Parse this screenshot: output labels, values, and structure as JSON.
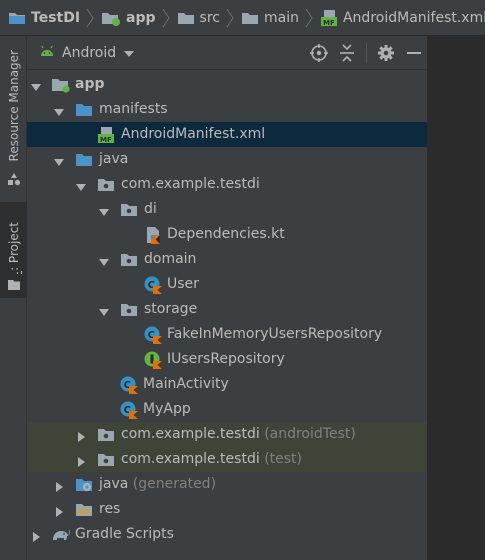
{
  "breadcrumb": {
    "items": [
      "TestDI",
      "app",
      "src",
      "main",
      "AndroidManifest.xml"
    ]
  },
  "toolstrip": {
    "resource_manager": "Resource Manager",
    "project_num": "1",
    "project_label": ": Project"
  },
  "panel": {
    "view": "Android"
  },
  "tree": {
    "app": "app",
    "manifests": "manifests",
    "android_manifest": "AndroidManifest.xml",
    "java": "java",
    "pkg_main": "com.example.testdi",
    "di": "di",
    "dependencies": "Dependencies.kt",
    "domain": "domain",
    "user": "User",
    "storage": "storage",
    "fake_repo": "FakeInMemoryUsersRepository",
    "iusers_repo": "IUsersRepository",
    "main_activity": "MainActivity",
    "my_app": "MyApp",
    "pkg_android_test": "com.example.testdi",
    "pkg_android_test_suffix": "(androidTest)",
    "pkg_test": "com.example.testdi",
    "pkg_test_suffix": "(test)",
    "java_generated": "java",
    "java_generated_suffix": "(generated)",
    "res": "res",
    "gradle": "Gradle Scripts"
  },
  "colors": {
    "folder_blue": "#4c93c9",
    "folder_gray": "#9aa7b0",
    "kotlin_class": "#3592c4",
    "interface_green": "#62b543",
    "selected_row": "#0d293e",
    "test_row": "#3e4538"
  },
  "icons": {
    "project": "folder-icon",
    "module": "module-folder-icon",
    "manifest": "manifest-file-icon",
    "kotlin_file": "kotlin-file-icon",
    "kotlin_class": "kotlin-class-icon",
    "kotlin_interface": "kotlin-interface-icon",
    "android": "android-icon",
    "gradle": "gradle-elephant-icon"
  }
}
